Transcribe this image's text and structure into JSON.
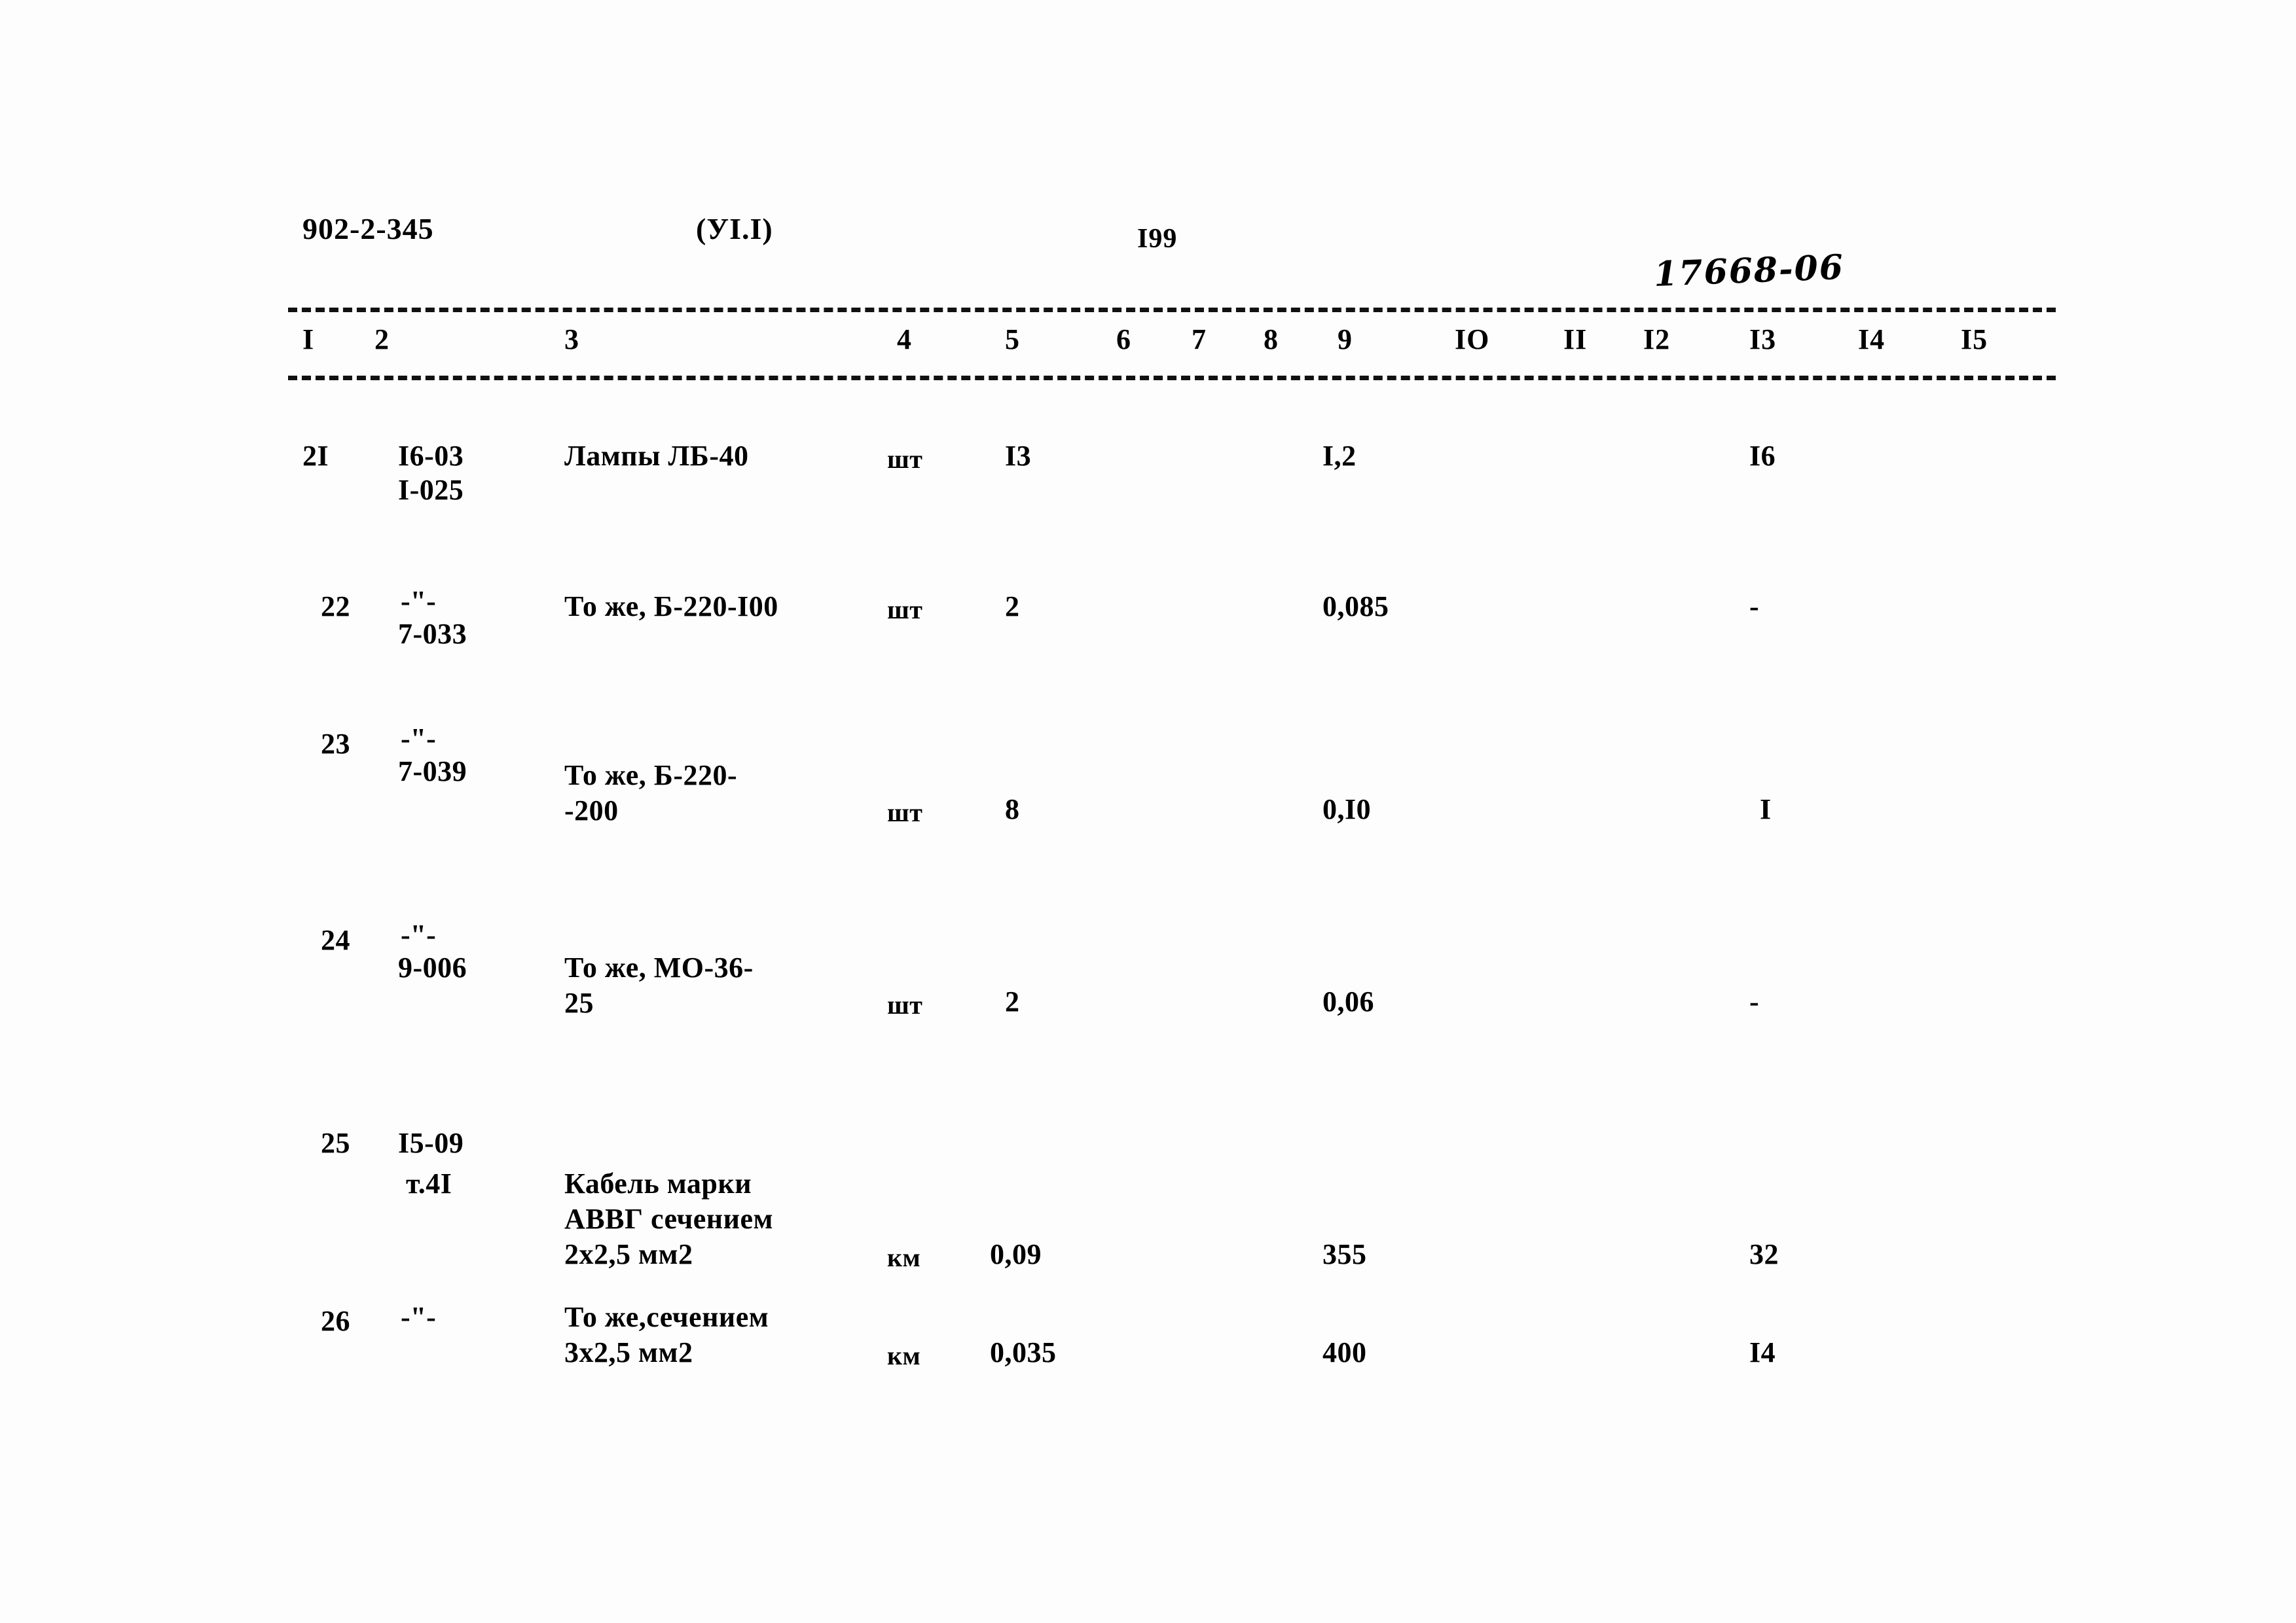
{
  "document": {
    "code": "902-2-345",
    "part": "(УI.I)",
    "page_number": "I99",
    "archive_stamp": "17668-06"
  },
  "table": {
    "column_headers": [
      "I",
      "2",
      "3",
      "4",
      "5",
      "6",
      "7",
      "8",
      "9",
      "IO",
      "II",
      "I2",
      "I3",
      "I4",
      "I5"
    ],
    "rows": [
      {
        "num": "2I",
        "code_line1": "I6-03",
        "code_line2": "I-025",
        "name_line1": "Лампы ЛБ-40",
        "name_line2": "",
        "name_line3": "",
        "unit": "шт",
        "qty": "I3",
        "col9": "I,2",
        "col13": "I6"
      },
      {
        "num": "22",
        "code_line1": "-\"-",
        "code_line2": "7-033",
        "name_line1": "То же, Б-220-I00",
        "name_line2": "",
        "name_line3": "",
        "unit": "шт",
        "qty": "2",
        "col9": "0,085",
        "col13": "-"
      },
      {
        "num": "23",
        "code_line1": "-\"-",
        "code_line2": "7-039",
        "name_line1": "То же, Б-220-",
        "name_line2": "-200",
        "name_line3": "",
        "unit": "шт",
        "qty": "8",
        "col9": "0,I0",
        "col13": "I"
      },
      {
        "num": "24",
        "code_line1": "-\"-",
        "code_line2": "9-006",
        "name_line1": "То же, МО-36-",
        "name_line2": "25",
        "name_line3": "",
        "unit": "шт",
        "qty": "2",
        "col9": "0,06",
        "col13": "-"
      },
      {
        "num": "25",
        "code_line1": "I5-09",
        "code_line2": "т.4I",
        "name_line1": "Кабель марки",
        "name_line2": "АВВГ сечением",
        "name_line3": "2х2,5 мм2",
        "unit": "км",
        "qty": "0,09",
        "col9": "355",
        "col13": "32"
      },
      {
        "num": "26",
        "code_line1": "-\"-",
        "code_line2": "",
        "name_line1": "То же,сечением",
        "name_line2": "3х2,5 мм2",
        "name_line3": "",
        "unit": "км",
        "qty": "0,035",
        "col9": "400",
        "col13": "I4"
      }
    ]
  }
}
